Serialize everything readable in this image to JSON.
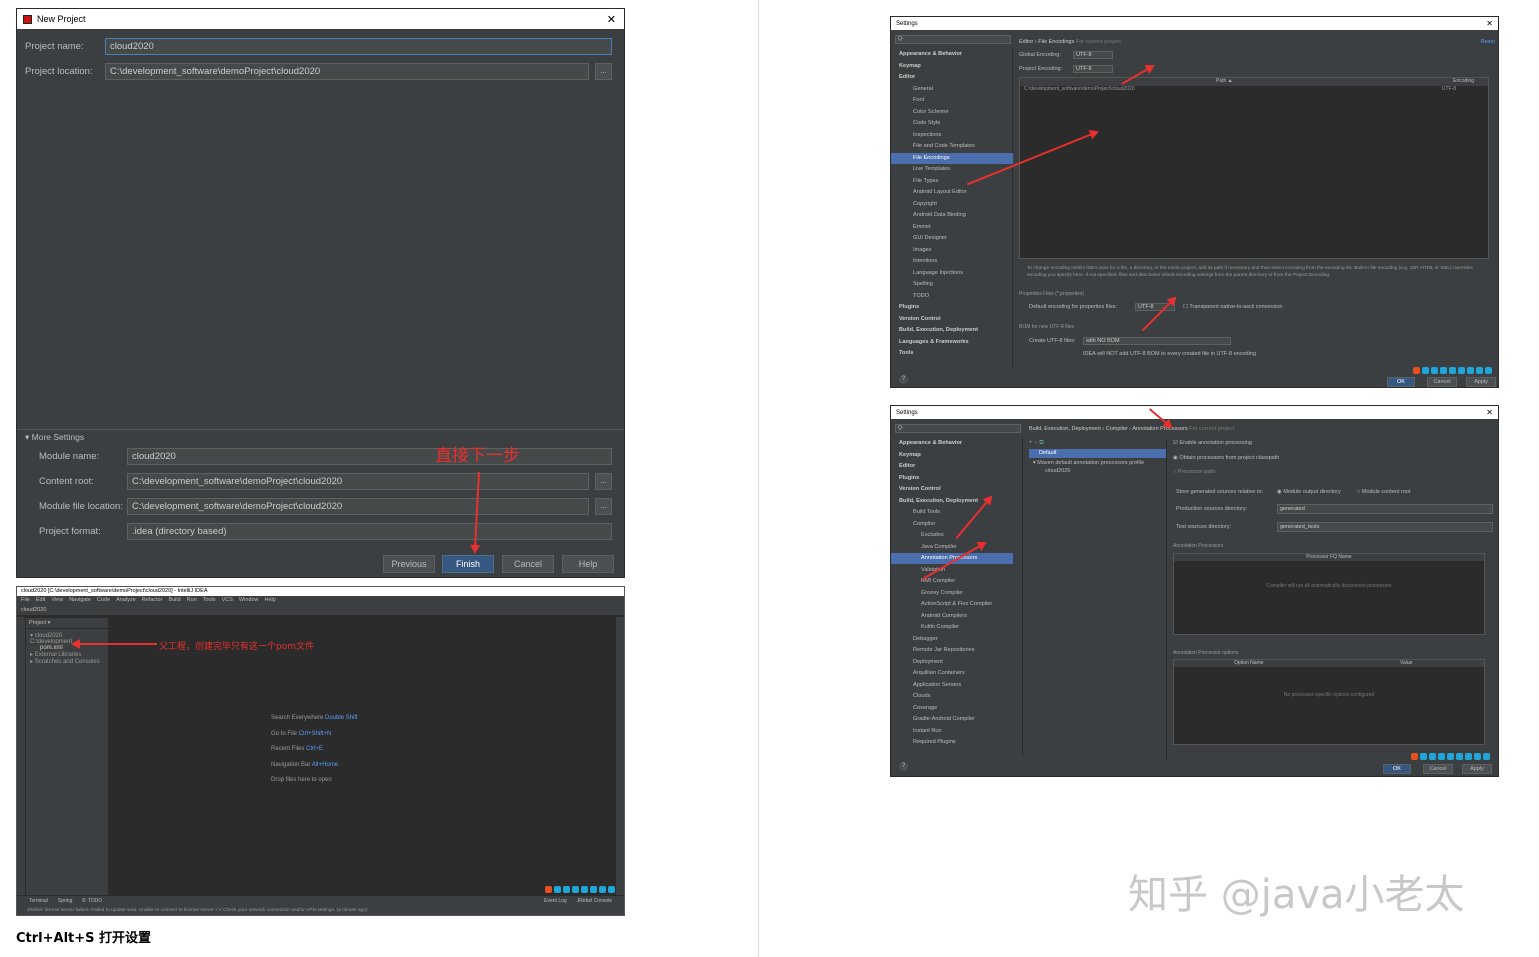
{
  "new_project": {
    "title": "New Project",
    "project_name_label": "Project name:",
    "project_name_value": "cloud2020",
    "project_location_label": "Project location:",
    "project_location_value": "C:\\development_software\\demoProject\\cloud2020",
    "more_settings": "More Settings",
    "module_name_label": "Module name:",
    "module_name_value": "cloud2020",
    "content_root_label": "Content root:",
    "content_root_value": "C:\\development_software\\demoProject\\cloud2020",
    "module_file_label": "Module file location:",
    "module_file_value": "C:\\development_software\\demoProject\\cloud2020",
    "project_format_label": "Project format:",
    "project_format_value": ".idea (directory based)",
    "browse": "...",
    "buttons": {
      "previous": "Previous",
      "finish": "Finish",
      "cancel": "Cancel",
      "help": "Help"
    },
    "annotation": "直接下一步"
  },
  "ide": {
    "title": "cloud2020 [C:\\development_software\\demoProject\\cloud2020] - IntelliJ IDEA",
    "menu": [
      "File",
      "Edit",
      "View",
      "Navigate",
      "Code",
      "Analyze",
      "Refactor",
      "Build",
      "Run",
      "Tools",
      "VCS",
      "Window",
      "Help"
    ],
    "breadcrumb": "cloud2020",
    "project_tab": "Project",
    "tree": [
      "cloud2020 C:\\development_",
      "pom.xml",
      "External Libraries",
      "Scratches and Consoles"
    ],
    "annotation": "父工程，创建完毕只有这一个pom文件",
    "hints": [
      {
        "label": "Search Everywhere",
        "key": "Double Shift"
      },
      {
        "label": "Go to File",
        "key": "Ctrl+Shift+N"
      },
      {
        "label": "Recent Files",
        "key": "Ctrl+E"
      },
      {
        "label": "Navigation Bar",
        "key": "Alt+Home"
      }
    ],
    "drop_hint": "Drop files here to open",
    "bottom_tabs": [
      "Terminal",
      "Spring",
      "6: TODO"
    ],
    "bottom_right": [
      "Event Log",
      "JRebel Console"
    ],
    "status": "JRebel: license server failure: Failed to update seat. Unable to connect to license server :/ // Check your network connection and/or VPN settings. (a minute ago)"
  },
  "caption": "Ctrl+Alt+S 打开设置",
  "settings1": {
    "title": "Settings",
    "search_placeholder": "Q-",
    "breadcrumb": [
      "Editor",
      "File Encodings"
    ],
    "for_project": "For current project",
    "reset": "Reset",
    "global_label": "Global Encoding:",
    "global_value": "UTF-8",
    "project_label": "Project Encoding:",
    "project_value": "UTF-8",
    "col_path": "Path ▲",
    "col_encoding": "Encoding",
    "row_path": "C:\\development_software\\demoProject\\cloud2020",
    "row_encoding": "UTF-8",
    "info": "To change encoding IntelliJ IDEA uses for a file, a directory, or the entire project, add its path if necessary and then select encoding from the encoding list. Built-in file encoding (e.g. JSP, HTML or XML) overrides encoding you specify here. If not specified, files and directories inherit encoding settings from the parent directory or from the Project Encoding.",
    "props_section": "Properties Files (*.properties)",
    "props_label": "Default encoding for properties files:",
    "props_value": "UTF-8",
    "transparent": "Transparent native-to-ascii conversion",
    "bom_section": "BOM for new UTF-8 files",
    "bom_label": "Create UTF-8 files:",
    "bom_value": "with NO BOM",
    "bom_note": "IDEA will NOT add UTF-8 BOM to every created file in UTF-8 encoding",
    "tree": [
      "Appearance & Behavior",
      "Keymap",
      "Editor",
      "General",
      "Font",
      "Color Scheme",
      "Code Style",
      "Inspections",
      "File and Code Templates",
      "File Encodings",
      "Live Templates",
      "File Types",
      "Android Layout Editor",
      "Copyright",
      "Android Data Binding",
      "Emmet",
      "GUI Designer",
      "Images",
      "Intentions",
      "Language Injections",
      "Spelling",
      "TODO",
      "Plugins",
      "Version Control",
      "Build, Execution, Deployment",
      "Languages & Frameworks",
      "Tools"
    ],
    "buttons": {
      "ok": "OK",
      "cancel": "Cancel",
      "apply": "Apply"
    }
  },
  "settings2": {
    "title": "Settings",
    "breadcrumb": [
      "Build, Execution, Deployment",
      "Compiler",
      "Annotation Processors"
    ],
    "for_project": "For current project",
    "profile_default": "Default",
    "profile_maven": "Maven default annotation processors profile",
    "profile_module": "cloud2020",
    "enable": "Enable annotation processing",
    "obtain": "Obtain processors from project classpath",
    "processor_path": "Processor path:",
    "store_label": "Store generated sources relative to:",
    "module_output": "Module output directory",
    "module_content": "Module content root",
    "prod_label": "Production sources directory:",
    "prod_value": "generated",
    "test_label": "Test sources directory:",
    "test_value": "generated_tests",
    "ap_section": "Annotation Processors",
    "ap_col": "Processor FQ Name",
    "ap_empty": "Compiler will run all automatically discovered processors",
    "opt_section": "Annotation Processor options",
    "opt_col1": "Option Name",
    "opt_col2": "Value",
    "opt_empty": "No processor-specific options configured",
    "tree": [
      "Appearance & Behavior",
      "Keymap",
      "Editor",
      "Plugins",
      "Version Control",
      "Build, Execution, Deployment",
      "Build Tools",
      "Compiler",
      "Excludes",
      "Java Compiler",
      "Annotation Processors",
      "Validation",
      "RMI Compiler",
      "Groovy Compiler",
      "ActionScript & Flex Compiler",
      "Android Compilers",
      "Kotlin Compiler",
      "Debugger",
      "Remote Jar Repositories",
      "Deployment",
      "Arquillian Containers",
      "Application Servers",
      "Clouds",
      "Coverage",
      "Gradle-Android Compiler",
      "Instant Run",
      "Required Plugins"
    ],
    "buttons": {
      "ok": "OK",
      "cancel": "Cancel",
      "apply": "Apply"
    }
  },
  "watermark": "知乎 @java小老太"
}
